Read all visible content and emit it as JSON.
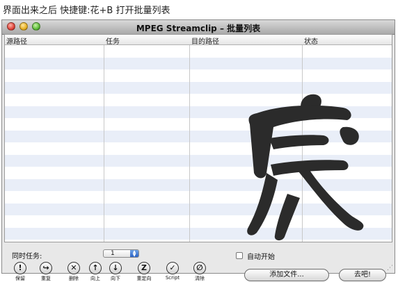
{
  "caption": "界面出来之后 快捷键:花+B 打开批量列表",
  "window": {
    "title": "MPEG Streamclip – 批量列表"
  },
  "table": {
    "columns": [
      "源路径",
      "任务",
      "目的路径",
      "状态"
    ],
    "rows": []
  },
  "controls": {
    "concurrent_label": "同时任务:",
    "concurrent_value": "1",
    "auto_start_label": "自动开始",
    "auto_start_checked": false
  },
  "toolbar": [
    {
      "name": "pause",
      "glyph": "!",
      "label": "保留",
      "icon": "exclamation-icon"
    },
    {
      "name": "repeat",
      "glyph": "↪",
      "label": "重复",
      "icon": "redo-icon"
    },
    {
      "name": "delete",
      "glyph": "✕",
      "label": "删除",
      "icon": "delete-icon"
    },
    {
      "name": "up",
      "glyph": "↑",
      "label": "向上",
      "icon": "arrow-up-icon"
    },
    {
      "name": "down",
      "glyph": "↓",
      "label": "向下",
      "icon": "arrow-down-icon"
    },
    {
      "name": "redirect",
      "glyph": "Z",
      "label": "重定向",
      "icon": "redirect-icon"
    },
    {
      "name": "script",
      "glyph": "✓",
      "label": "Script",
      "icon": "check-icon"
    },
    {
      "name": "clear",
      "glyph": "∅",
      "label": "清除",
      "icon": "clear-icon"
    }
  ],
  "buttons": {
    "add_files": "添加文件...",
    "go": "去吧!"
  }
}
